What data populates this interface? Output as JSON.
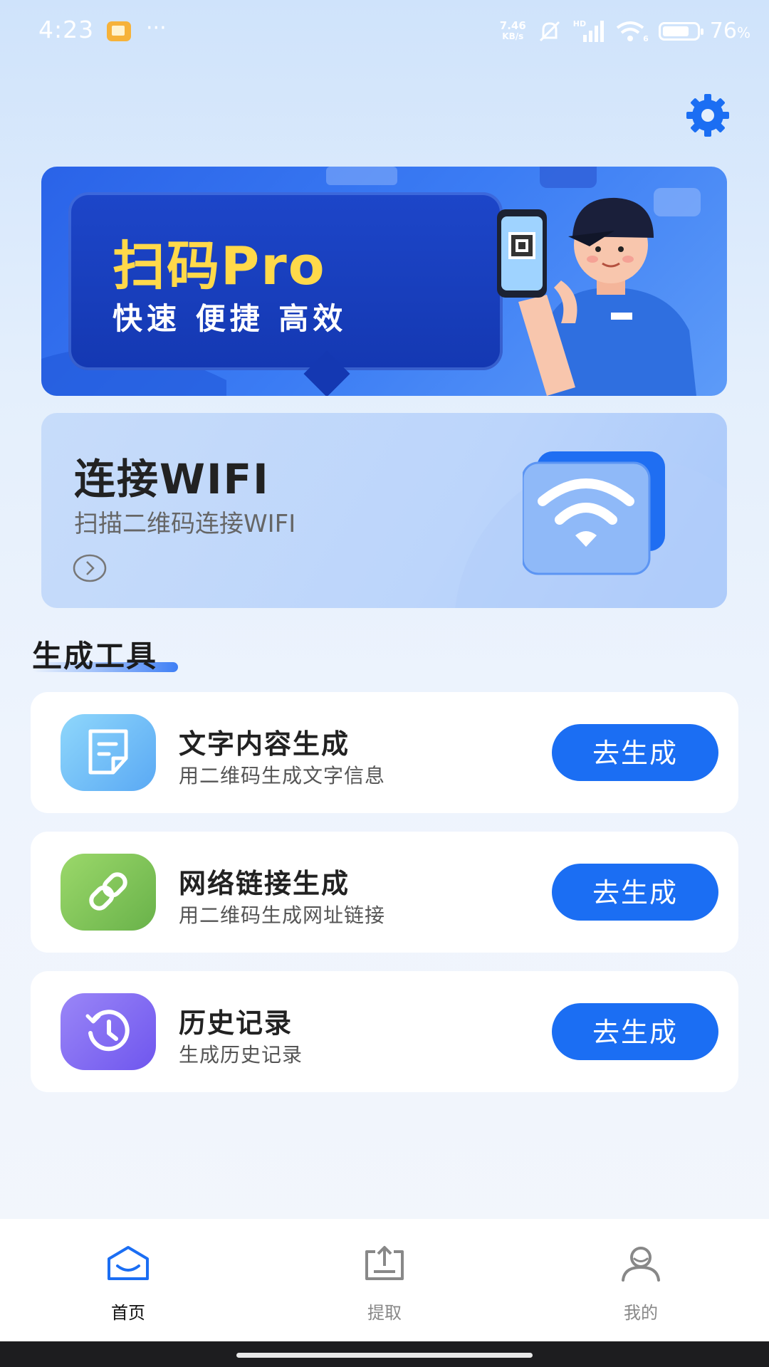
{
  "status_bar": {
    "time": "4:23",
    "more": "···",
    "net_speed_value": "7.46",
    "net_speed_unit": "KB/s",
    "hd_label": "HD",
    "wifi_label": "6",
    "battery_percent": "76",
    "battery_unit": "%"
  },
  "banner": {
    "title": "扫码Pro",
    "subtitle": "快速  便捷  高效"
  },
  "wifi_card": {
    "title": "连接WIFI",
    "subtitle": "扫描二维码连接WIFI"
  },
  "section": {
    "title": "生成工具"
  },
  "tools": [
    {
      "name": "文字内容生成",
      "desc": "用二维码生成文字信息",
      "button": "去生成",
      "icon": "note-icon",
      "color": "#7cc6f6"
    },
    {
      "name": "网络链接生成",
      "desc": "用二维码生成网址链接",
      "button": "去生成",
      "icon": "link-icon",
      "color": "#86c85a"
    },
    {
      "name": "历史记录",
      "desc": "生成历史记录",
      "button": "去生成",
      "icon": "history-icon",
      "color": "#8a6ef5"
    }
  ],
  "nav": [
    {
      "label": "首页",
      "icon": "home-icon",
      "active": true
    },
    {
      "label": "提取",
      "icon": "upload-icon",
      "active": false
    },
    {
      "label": "我的",
      "icon": "user-icon",
      "active": false
    }
  ],
  "colors": {
    "accent": "#1b6ef3",
    "banner_title": "#ffd94a"
  }
}
